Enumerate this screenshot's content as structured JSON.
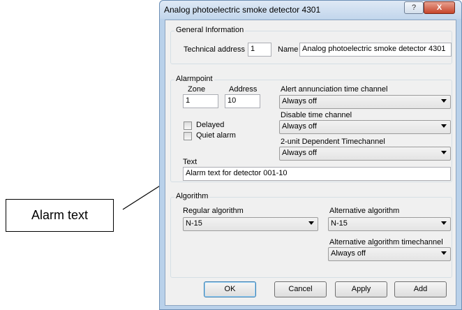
{
  "window": {
    "title": "Analog photoelectric smoke detector 4301",
    "help_glyph": "?",
    "close_glyph": "X"
  },
  "general": {
    "group_label": "General Information",
    "tech_address_label": "Technical address",
    "tech_address_value": "1",
    "name_label": "Name",
    "name_value": "Analog photoelectric smoke detector 4301"
  },
  "alarmpoint": {
    "group_label": "Alarmpoint",
    "zone_label": "Zone",
    "zone_value": "1",
    "address_label": "Address",
    "address_value": "10",
    "alert_channel_label": "Alert annunciation time channel",
    "alert_channel_value": "Always off",
    "disable_channel_label": "Disable time channel",
    "disable_channel_value": "Always off",
    "twounit_channel_label": "2-unit Dependent Timechannel",
    "twounit_channel_value": "Always off",
    "delayed_label": "Delayed",
    "quiet_alarm_label": "Quiet alarm",
    "text_label": "Text",
    "text_value": "Alarm text for detector 001-10"
  },
  "algorithm": {
    "group_label": "Algorithm",
    "regular_label": "Regular algorithm",
    "regular_value": "N-15",
    "alternative_label": "Alternative algorithm",
    "alternative_value": "N-15",
    "alt_timechannel_label": "Alternative algorithm timechannel",
    "alt_timechannel_value": "Always off"
  },
  "buttons": {
    "ok": "OK",
    "cancel": "Cancel",
    "apply": "Apply",
    "add": "Add"
  },
  "callout": {
    "text": "Alarm text"
  }
}
